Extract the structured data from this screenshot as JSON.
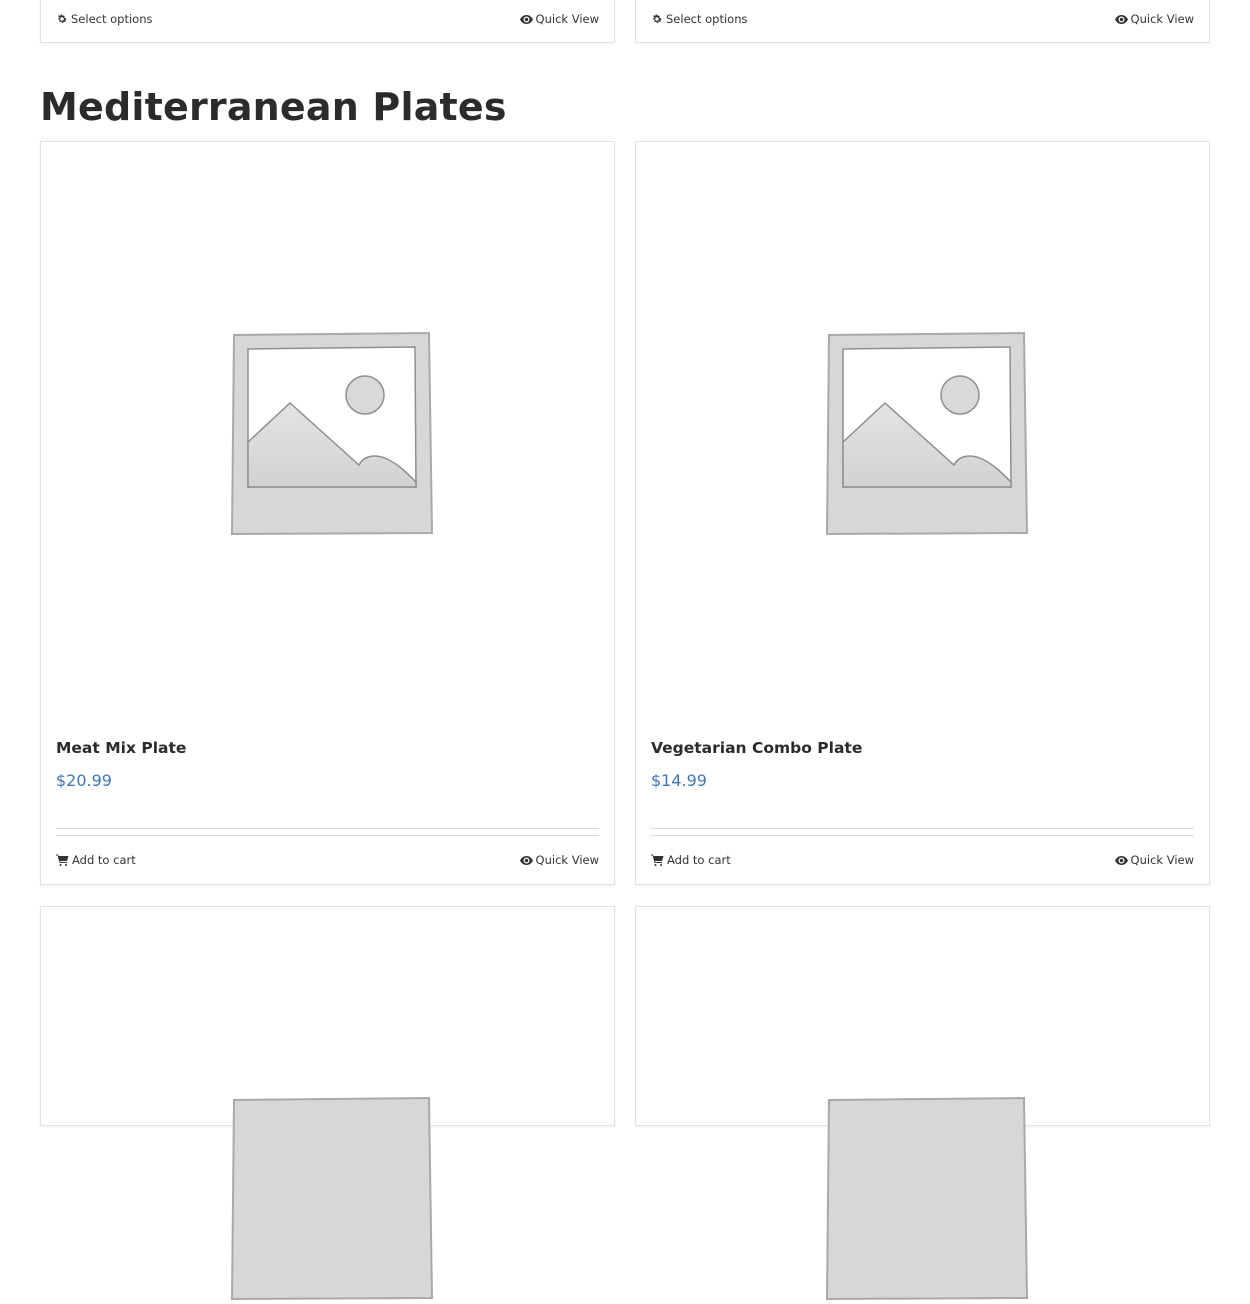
{
  "top_row": {
    "left": {
      "select_label": "Select options",
      "quickview_label": "Quick View"
    },
    "right": {
      "select_label": "Select options",
      "quickview_label": "Quick View"
    }
  },
  "section": {
    "title": "Mediterranean Plates"
  },
  "products": [
    {
      "name": "Meat Mix Plate",
      "price": "$20.99",
      "cart_label": "Add to cart",
      "quickview_label": "Quick View",
      "image_icon": "image-placeholder-icon"
    },
    {
      "name": "Vegetarian Combo Plate",
      "price": "$14.99",
      "cart_label": "Add to cart",
      "quickview_label": "Quick View",
      "image_icon": "image-placeholder-icon"
    }
  ],
  "colors": {
    "price": "#3f76b6",
    "title": "#2b2b2b",
    "border": "#e2e2e2"
  },
  "icons": {
    "select": "gear-icon",
    "quickview": "eye-icon",
    "cart": "cart-icon"
  }
}
